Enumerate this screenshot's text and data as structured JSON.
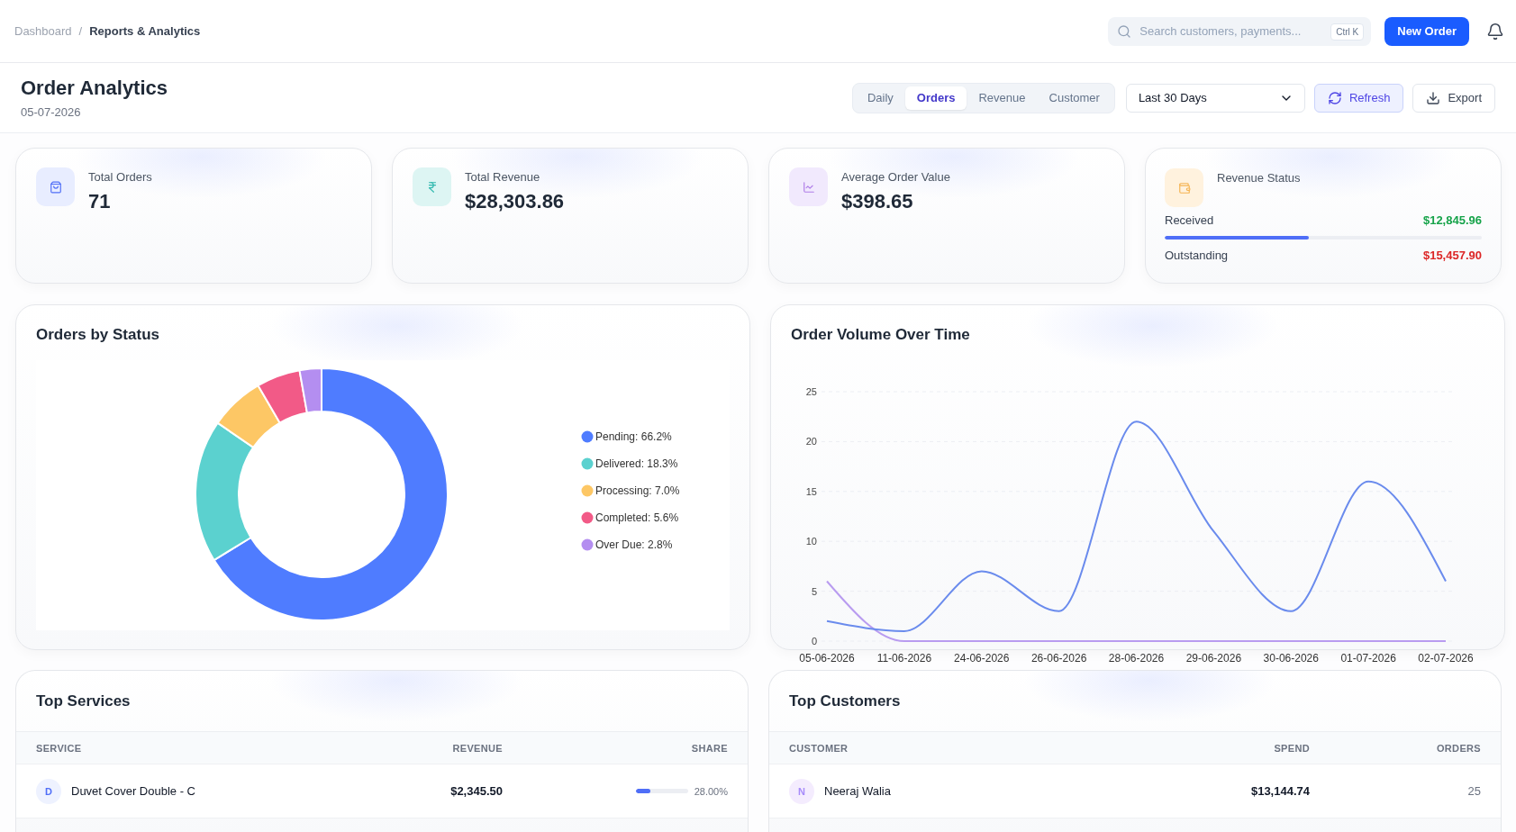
{
  "breadcrumb": {
    "separator": "/",
    "items": [
      {
        "label": "Dashboard",
        "current": false
      },
      {
        "label": "Reports & Analytics",
        "current": true
      }
    ]
  },
  "search": {
    "placeholder": "Search customers, payments...",
    "shortcut": "Ctrl K"
  },
  "new_order_button": {
    "label": "New Order"
  },
  "page_header": {
    "title": "Order Analytics",
    "date": "05-07-2026"
  },
  "view_tabs": [
    {
      "label": "Daily",
      "selected": false
    },
    {
      "label": "Orders",
      "selected": true
    },
    {
      "label": "Revenue",
      "selected": false
    },
    {
      "label": "Customer",
      "selected": false
    }
  ],
  "range_select": {
    "value": "Last 30 Days"
  },
  "actions": [
    {
      "kind": "refresh",
      "label": "Refresh"
    },
    {
      "kind": "export",
      "label": "Export"
    }
  ],
  "stats": [
    {
      "kind": "orders",
      "label": "Total Orders",
      "value": "71"
    },
    {
      "kind": "revenue",
      "label": "Total Revenue",
      "value": "$28,303.86"
    },
    {
      "kind": "average",
      "label": "Average Order Value",
      "value": "$398.65"
    }
  ],
  "revenue_status": {
    "label": "Revenue Status",
    "received_label": "Received",
    "received_amount": "$12,845.96",
    "level": 0.454,
    "outstanding_label": "Outstanding",
    "outstanding_amount": "$15,457.90"
  },
  "orders_by_status": {
    "title": "Orders by Status",
    "chart_data": {
      "type": "donut",
      "values": [
        66.2,
        18.3,
        7.0,
        5.6,
        2.8
      ]
    },
    "legend": [
      {
        "label": "Pending: 66.2%",
        "color": "#4f7cff"
      },
      {
        "label": "Delivered: 18.3%",
        "color": "#5bd1cf"
      },
      {
        "label": "Processing: 7.0%",
        "color": "#fdc765"
      },
      {
        "label": "Completed: 5.6%",
        "color": "#f25a87"
      },
      {
        "label": "Over Due: 2.8%",
        "color": "#b48ef0"
      }
    ]
  },
  "order_volume": {
    "title": "Order Volume Over Time",
    "chart_data": {
      "type": "line",
      "grid": true,
      "categories": [
        "05-06-2026",
        "11-06-2026",
        "24-06-2026",
        "26-06-2026",
        "28-06-2026",
        "29-06-2026",
        "30-06-2026",
        "01-07-2026",
        "02-07-2026"
      ],
      "ylim": [
        0,
        25
      ],
      "yticks": [
        0,
        5,
        10,
        15,
        20,
        25
      ],
      "series": [
        {
          "color": "#6a8bed",
          "values": [
            2,
            1,
            7,
            3,
            22,
            11,
            3,
            16,
            6
          ]
        },
        {
          "color": "#b99cf0",
          "values": [
            6,
            0,
            0,
            0,
            0,
            0,
            0,
            0,
            0
          ]
        }
      ]
    }
  },
  "top_services": {
    "title": "Top Services",
    "columns": [
      "SERVICE",
      "REVENUE",
      "SHARE"
    ],
    "rows": [
      {
        "initial": "D",
        "name": "Duvet Cover Double - C",
        "revenue": "$2,345.50",
        "share": "28.00%",
        "level": 0.28
      }
    ]
  },
  "top_customers": {
    "title": "Top Customers",
    "columns": [
      "CUSTOMER",
      "SPEND",
      "ORDERS"
    ],
    "rows": [
      {
        "initial": "N",
        "name": "Neeraj Walia",
        "spend": "$13,144.74",
        "orders": "25"
      }
    ]
  }
}
